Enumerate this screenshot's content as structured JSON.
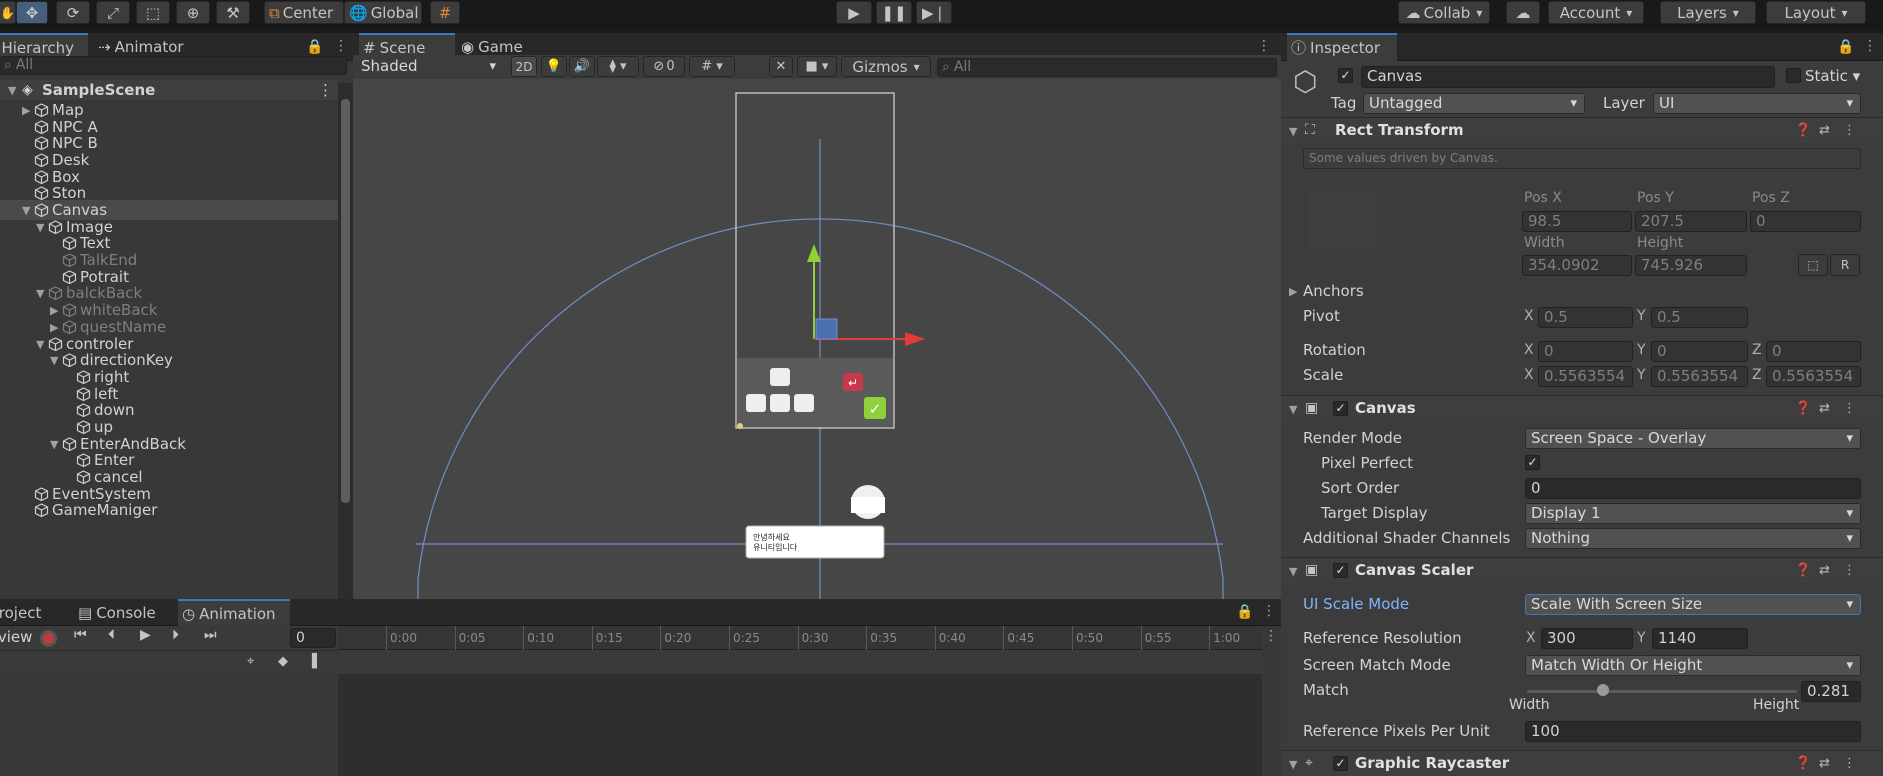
{
  "toolbar": {
    "pivot_label": "Center",
    "space_label": "Global",
    "collab_label": "Collab",
    "account_label": "Account",
    "layers_label": "Layers",
    "layout_label": "Layout"
  },
  "hierarchy": {
    "tabs": [
      {
        "label": "Hierarchy"
      },
      {
        "label": "Animator"
      }
    ],
    "search_placeholder": "All",
    "scene_name": "SampleScene",
    "items": [
      {
        "label": "Map"
      },
      {
        "label": "NPC A"
      },
      {
        "label": "NPC B"
      },
      {
        "label": "Desk"
      },
      {
        "label": "Box"
      },
      {
        "label": "Ston"
      },
      {
        "label": "Canvas"
      },
      {
        "label": "Image"
      },
      {
        "label": "Text"
      },
      {
        "label": "TalkEnd"
      },
      {
        "label": "Potrait"
      },
      {
        "label": "balckBack"
      },
      {
        "label": "whiteBack"
      },
      {
        "label": "questName"
      },
      {
        "label": "controler"
      },
      {
        "label": "directionKey"
      },
      {
        "label": "right"
      },
      {
        "label": "left"
      },
      {
        "label": "down"
      },
      {
        "label": "up"
      },
      {
        "label": "EnterAndBack"
      },
      {
        "label": "Enter"
      },
      {
        "label": "cancel"
      },
      {
        "label": "EventSystem"
      },
      {
        "label": "GameManiger"
      }
    ]
  },
  "scene": {
    "tabs": [
      {
        "label": "Scene"
      },
      {
        "label": "Game"
      }
    ],
    "shading_mode": "Shaded",
    "mode_2d": "2D",
    "hidden_count": "0",
    "gizmos_label": "Gizmos",
    "search_placeholder": "All",
    "dialog_text": "안녕하세요\n유니티입니다"
  },
  "bottom": {
    "tabs": [
      {
        "label": "Project"
      },
      {
        "label": "Console"
      },
      {
        "label": "Animation"
      }
    ],
    "preview_label": "Preview",
    "frame_value": "0",
    "timeline_ticks": [
      "0:00",
      "0:05",
      "0:10",
      "0:15",
      "0:20",
      "0:25",
      "0:30",
      "0:35",
      "0:40",
      "0:45",
      "0:50",
      "0:55",
      "1:00"
    ]
  },
  "inspector": {
    "tab_label": "Inspector",
    "object_name": "Canvas",
    "static_label": "Static",
    "tag_label": "Tag",
    "tag_value": "Untagged",
    "layer_label": "Layer",
    "layer_value": "UI",
    "rect_transform": {
      "title": "Rect Transform",
      "driven_note": "Some values driven by Canvas.",
      "pos_x_label": "Pos X",
      "pos_y_label": "Pos Y",
      "pos_z_label": "Pos Z",
      "pos_x": "98.5",
      "pos_y": "207.5",
      "pos_z": "0",
      "width_label": "Width",
      "height_label": "Height",
      "width": "354.0902",
      "height": "745.926",
      "anchors_label": "Anchors",
      "pivot_label": "Pivot",
      "pivot_x": "0.5",
      "pivot_y": "0.5",
      "rotation_label": "Rotation",
      "rot_x": "0",
      "rot_y": "0",
      "rot_z": "0",
      "scale_label": "Scale",
      "scale_x": "0.5563554",
      "scale_y": "0.5563554",
      "scale_z": "0.5563554"
    },
    "canvas": {
      "title": "Canvas",
      "render_mode_label": "Render Mode",
      "render_mode": "Screen Space - Overlay",
      "pixel_perfect_label": "Pixel Perfect",
      "sort_order_label": "Sort Order",
      "sort_order": "0",
      "target_display_label": "Target Display",
      "target_display": "Display 1",
      "shader_channels_label": "Additional Shader Channels",
      "shader_channels": "Nothing"
    },
    "canvas_scaler": {
      "title": "Canvas Scaler",
      "ui_scale_mode_label": "UI Scale Mode",
      "ui_scale_mode": "Scale With Screen Size",
      "ref_res_label": "Reference Resolution",
      "ref_x": "300",
      "ref_y": "1140",
      "match_mode_label": "Screen Match Mode",
      "match_mode": "Match Width Or Height",
      "match_label": "Match",
      "match_value": "0.281",
      "width_label": "Width",
      "height_label": "Height",
      "ppu_label": "Reference Pixels Per Unit",
      "ppu": "100"
    },
    "raycaster": {
      "title": "Graphic Raycaster"
    }
  },
  "colors": {
    "accent": "#3a79bb",
    "link": "#7fb4ff",
    "axis_x": "#e03c3c",
    "axis_y": "#8fd13b"
  }
}
